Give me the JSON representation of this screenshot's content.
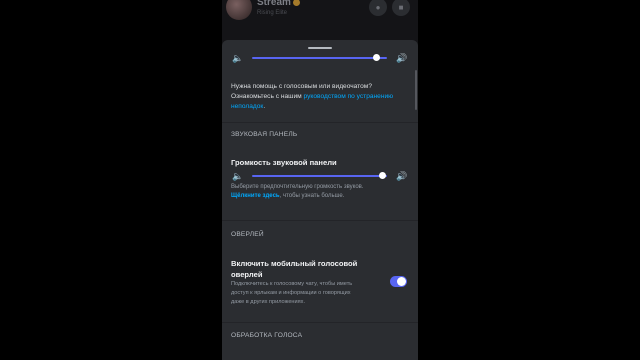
{
  "header": {
    "channel_name": "Stream",
    "subtitle": "Rising Elite"
  },
  "voice_help": {
    "line1": "Нужна помощь с голосовым или видеочатом?",
    "line2_prefix": "Ознакомьтесь с нашим ",
    "link": "руководством по устранению неполадок",
    "suffix": "."
  },
  "voice_volume_level": 0.92,
  "soundboard": {
    "section_title": "ЗВУКОВАЯ ПАНЕЛЬ",
    "volume_label": "Громкость звуковой панели",
    "volume_level": 0.97,
    "description": "Выберите предпочтительную громкость звуков.",
    "link": "Щёлкните здесь",
    "link_suffix": ", чтобы узнать больше."
  },
  "overlay": {
    "section_title": "ОВЕРЛЕЙ",
    "toggle_label_line1": "Включить мобильный голосовой",
    "toggle_label_line2": "оверлей",
    "description_line1": "Подключитесь к голосовому чату, чтобы иметь",
    "description_line2": "доступ к ярлыкам и информации о говорящих",
    "description_line3": "даже в других приложениях.",
    "enabled": true
  },
  "voice_processing": {
    "section_title": "ОБРАБОТКА ГОЛОСА"
  },
  "icons": {
    "mute": "volume-mute-icon",
    "loud": "volume-up-icon"
  },
  "colors": {
    "accent": "#5865f2",
    "link": "#00a8fc"
  }
}
